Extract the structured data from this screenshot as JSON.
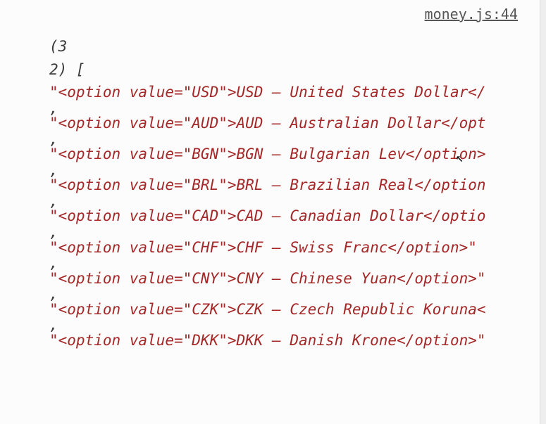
{
  "source": {
    "file": "money.js",
    "line": "44",
    "label": "money.js:44"
  },
  "array_header": {
    "count_line1": "(3",
    "count_line2_open": "2) ["
  },
  "comma": ",",
  "items": [
    "\"<option value=\"USD\">USD – United States Dollar</",
    "\"<option value=\"AUD\">AUD – Australian Dollar</opt",
    "\"<option value=\"BGN\">BGN – Bulgarian Lev</option>",
    "\"<option value=\"BRL\">BRL – Brazilian Real</option",
    "\"<option value=\"CAD\">CAD – Canadian Dollar</optio",
    "\"<option value=\"CHF\">CHF – Swiss Franc</option>\" ",
    "\"<option value=\"CNY\">CNY – Chinese Yuan</option>\"",
    "\"<option value=\"CZK\">CZK – Czech Republic Koruna<",
    "\"<option value=\"DKK\">DKK – Danish Krone</option>\""
  ]
}
